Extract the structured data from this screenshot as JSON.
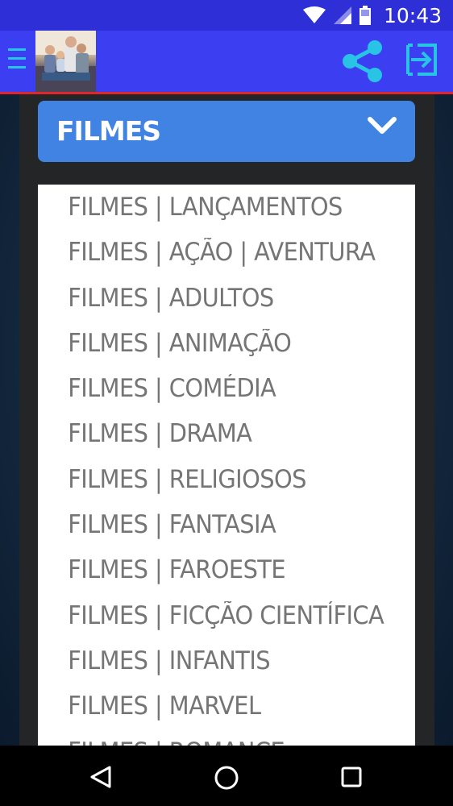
{
  "status_bar": {
    "time": "10:43",
    "icons": [
      "wifi-icon",
      "signal-icon",
      "battery-icon"
    ]
  },
  "app_bar": {
    "menu_icon": "hamburger-menu-icon",
    "logo": "family-photo-logo",
    "actions": [
      "share-icon",
      "exit-icon"
    ],
    "accent_color": "#3b3ff1",
    "icon_color": "#29c3e6"
  },
  "dropdown": {
    "selected": "FILMES",
    "icon": "chevron-down-icon",
    "color": "#4183e3"
  },
  "list": {
    "items": [
      "FILMES | LANÇAMENTOS",
      "FILMES | AÇÃO | AVENTURA",
      "FILMES | ADULTOS",
      "FILMES | ANIMAÇÃO",
      "FILMES | COMÉDIA",
      "FILMES | DRAMA",
      "FILMES | RELIGIOSOS",
      "FILMES | FANTASIA",
      "FILMES | FAROESTE",
      "FILMES | FICÇÃO CIENTÍFICA",
      "FILMES | INFANTIS",
      "FILMES | MARVEL",
      "FILMES | ROMANCE"
    ]
  },
  "nav_bar": {
    "buttons": [
      "back-icon",
      "home-icon",
      "recent-apps-icon"
    ]
  }
}
